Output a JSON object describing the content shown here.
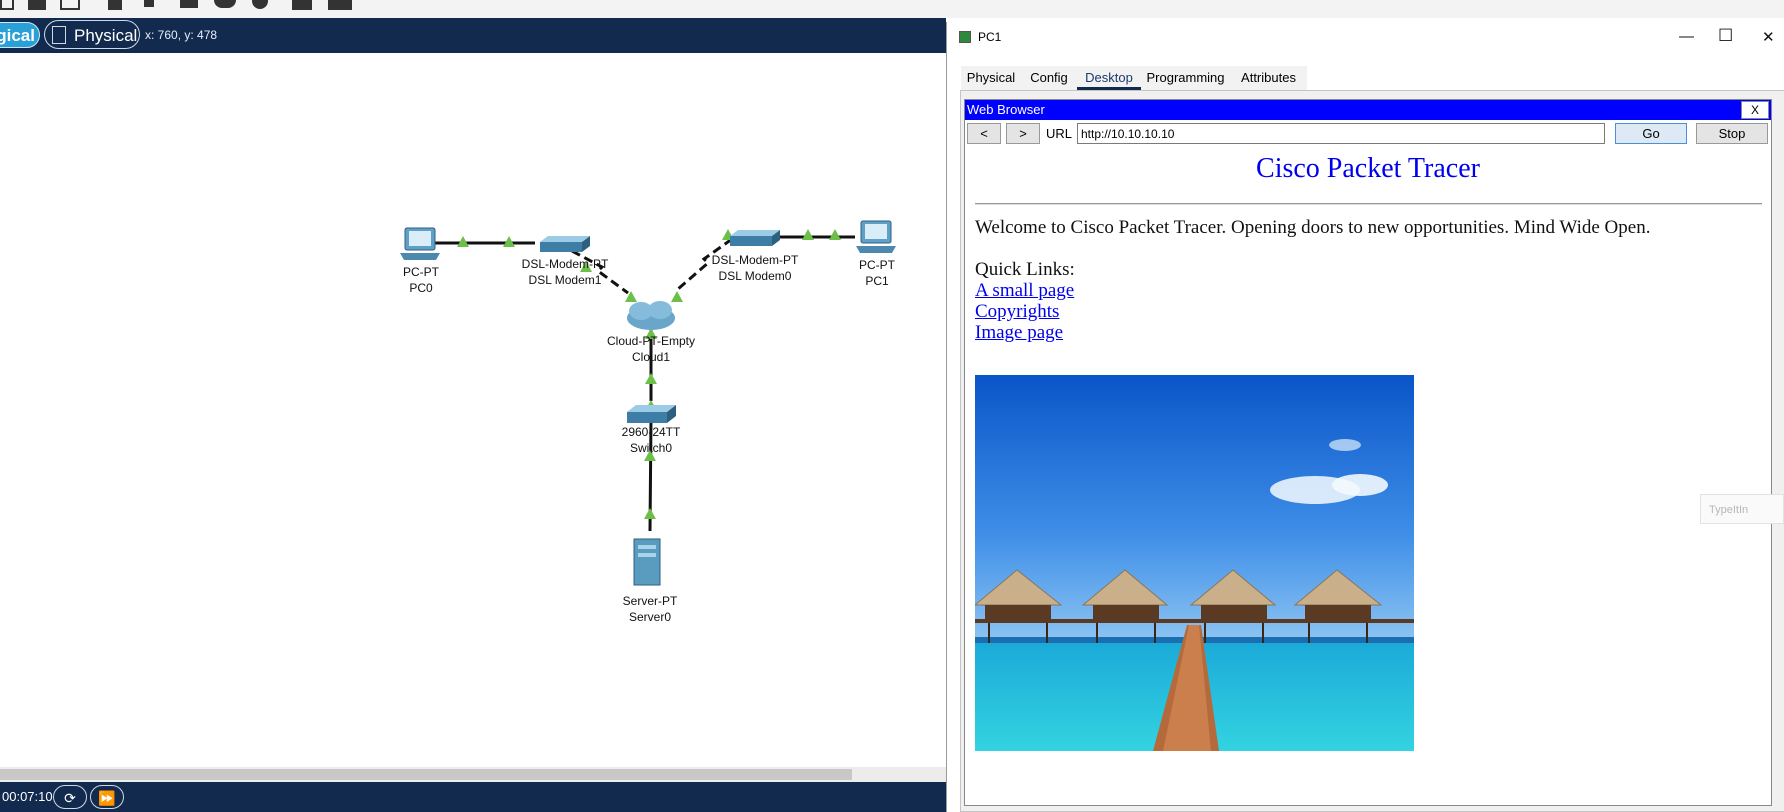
{
  "toolbar": {
    "icons": [
      "zoom-icon",
      "inspect-icon",
      "resize-icon",
      "note-icon",
      "draw-line-icon",
      "rectangle-icon",
      "ellipse-icon",
      "freeform-icon",
      "palette-icon",
      "custom-device-icon"
    ]
  },
  "modebar": {
    "logical_label": "gical",
    "physical_label": "Physical",
    "coords": "x: 760, y: 478"
  },
  "devices": [
    {
      "type": "PC-PT",
      "name": "PC0",
      "icon": "pc-icon"
    },
    {
      "type": "DSL-Modem-PT",
      "name": "DSL Modem1",
      "icon": "modem-icon"
    },
    {
      "type": "DSL-Modem-PT",
      "name": "DSL Modem0",
      "icon": "modem-icon"
    },
    {
      "type": "PC-PT",
      "name": "PC1",
      "icon": "pc-icon"
    },
    {
      "type": "Cloud-PT-Empty",
      "name": "Cloud1",
      "icon": "cloud-icon"
    },
    {
      "type": "2960-24TT",
      "name": "Switch0",
      "icon": "switch-icon"
    },
    {
      "type": "Server-PT",
      "name": "Server0",
      "icon": "server-icon"
    }
  ],
  "bottombar": {
    "time": "00:07:10",
    "reset_icon": "power-cycle-icon",
    "fast_forward_icon": "fast-forward-icon"
  },
  "window": {
    "title": "PC1",
    "minimize": "—",
    "maximize": "☐",
    "close": "✕",
    "tabs": [
      {
        "label": "Physical",
        "active": false
      },
      {
        "label": "Config",
        "active": false
      },
      {
        "label": "Desktop",
        "active": true
      },
      {
        "label": "Programming",
        "active": false
      },
      {
        "label": "Attributes",
        "active": false
      }
    ]
  },
  "browser": {
    "title": "Web Browser",
    "close_label": "X",
    "back_label": "<",
    "forward_label": ">",
    "url_label": "URL",
    "url_value": "http://10.10.10.10",
    "go_label": "Go",
    "stop_label": "Stop"
  },
  "webpage": {
    "heading": "Cisco Packet Tracer",
    "welcome": "Welcome to Cisco Packet Tracer. Opening doors to new opportunities. Mind Wide Open.",
    "quick_links_heading": "Quick Links:",
    "links": [
      "A small page",
      "Copyrights",
      "Image page"
    ],
    "image": "beach-bungalows-image"
  },
  "overlay": {
    "typeit_label": "TypeItIn"
  },
  "colors": {
    "bar_bg": "#112a4e",
    "active_mode": "#2aa0d8",
    "browser_title": "#0000ff",
    "link": "#0000ee",
    "link_up": "#6cc04a"
  }
}
